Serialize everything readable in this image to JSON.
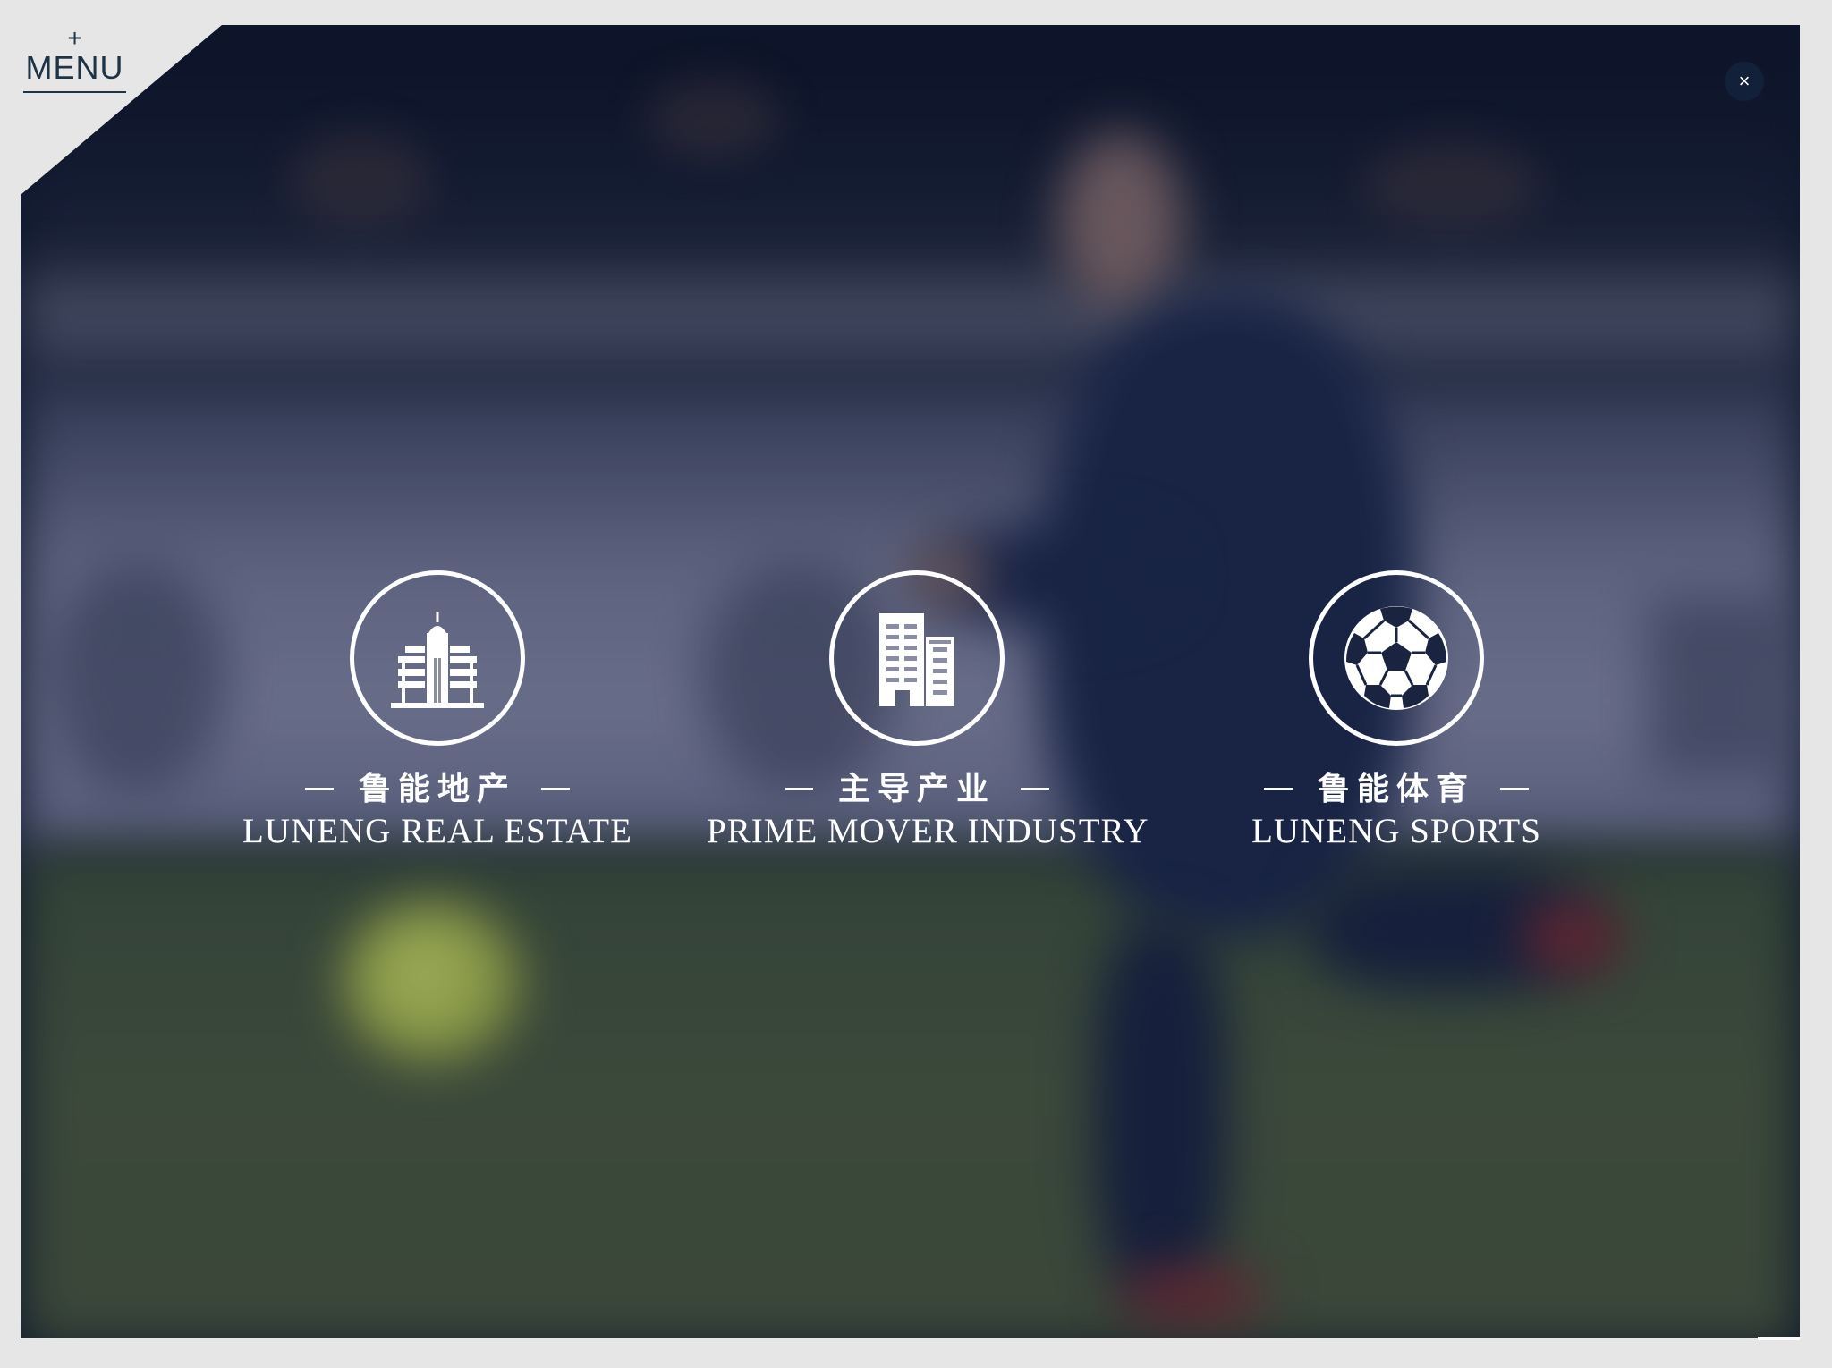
{
  "menu": {
    "plus": "+",
    "label": "MENU"
  },
  "close": {
    "glyph": "×"
  },
  "businesses": [
    {
      "icon": "building-icon",
      "cn": "鲁能地产",
      "en": "LUNENG REAL ESTATE"
    },
    {
      "icon": "office-building-icon",
      "cn": "主导产业",
      "en": "PRIME MOVER INDUSTRY"
    },
    {
      "icon": "soccer-ball-icon",
      "cn": "鲁能体育",
      "en": "LUNENG SPORTS"
    }
  ],
  "colors": {
    "menu_text": "#1d3346",
    "close_bg": "#13203a",
    "overlay_text": "#ffffff",
    "page_bg": "#e6e6e6"
  }
}
